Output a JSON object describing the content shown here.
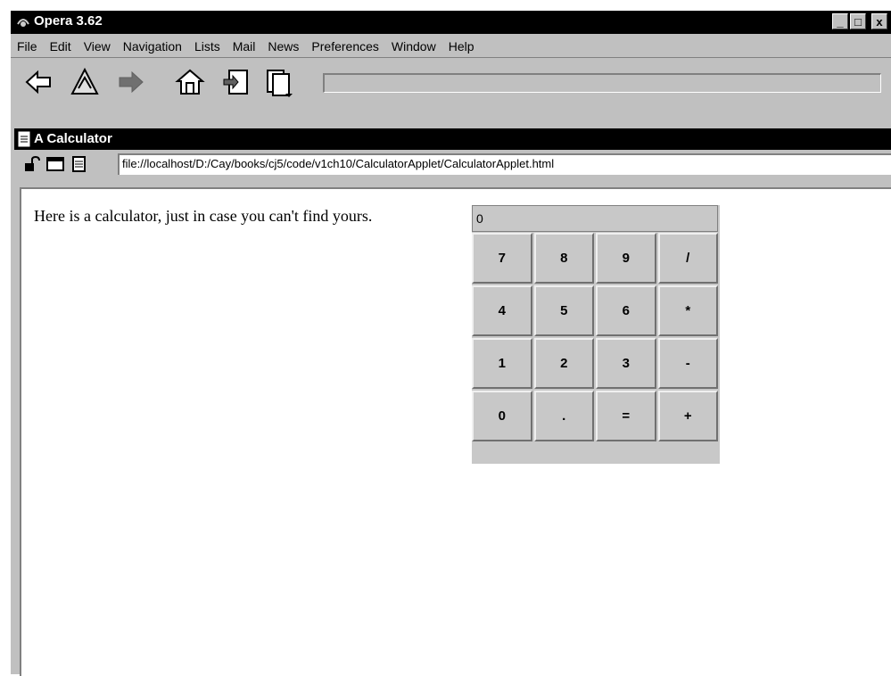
{
  "window": {
    "title": "Opera 3.62"
  },
  "window_buttons": {
    "minimize": "_",
    "restore": "□",
    "close": "x"
  },
  "menu": [
    "File",
    "Edit",
    "View",
    "Navigation",
    "Lists",
    "Mail",
    "News",
    "Preferences",
    "Window",
    "Help"
  ],
  "toolbar": {
    "icons": [
      "back-arrow-icon",
      "hotlist-icon",
      "forward-arrow-icon",
      "home-icon",
      "load-images-icon",
      "page-list-icon"
    ]
  },
  "document": {
    "title": "A Calculator",
    "url": "file://localhost/D:/Cay/books/cj5/code/v1ch10/CalculatorApplet/CalculatorApplet.html",
    "intro_text": "Here is a calculator, just in case you can't find yours."
  },
  "calculator": {
    "display": "0",
    "keys": [
      "7",
      "8",
      "9",
      "/",
      "4",
      "5",
      "6",
      "*",
      "1",
      "2",
      "3",
      "-",
      "0",
      ".",
      "=",
      "+"
    ]
  },
  "colors": {
    "title_bar": "#000000",
    "chrome": "#c0c0c0",
    "content_bg": "#ffffff"
  }
}
